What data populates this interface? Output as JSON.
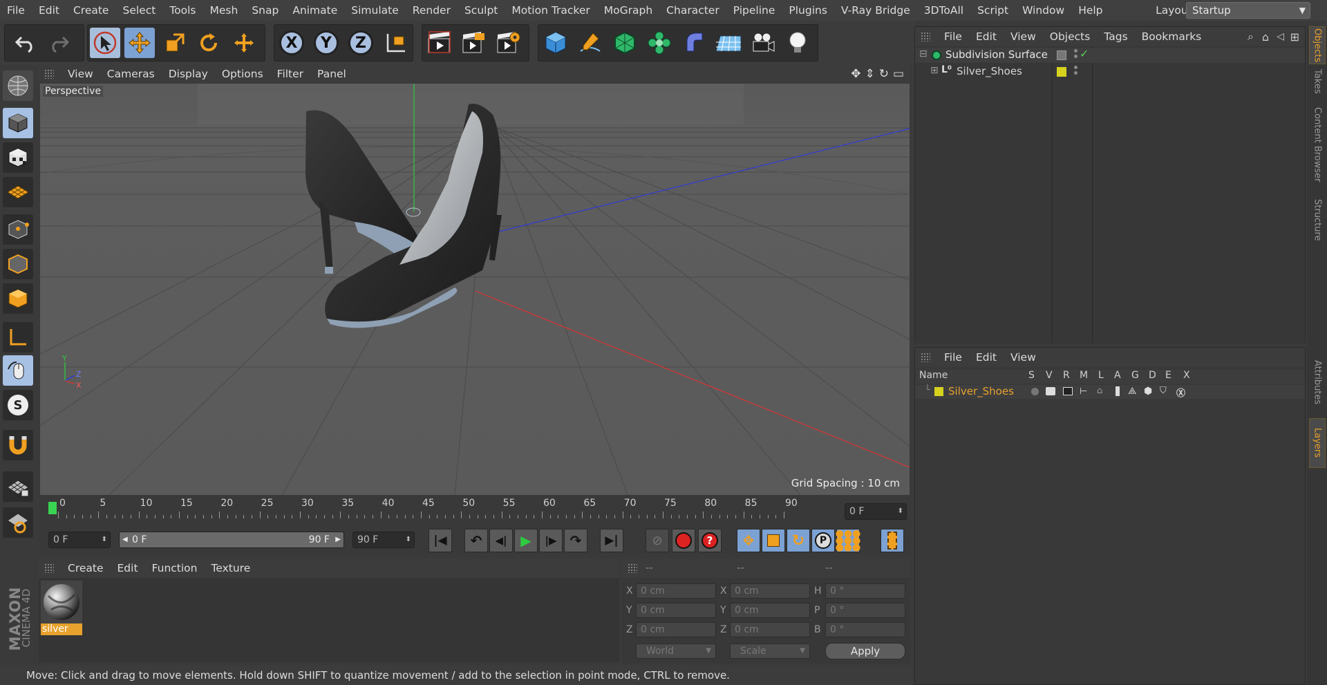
{
  "menubar": {
    "items": [
      "File",
      "Edit",
      "Create",
      "Select",
      "Tools",
      "Mesh",
      "Snap",
      "Animate",
      "Simulate",
      "Render",
      "Sculpt",
      "Motion Tracker",
      "MoGraph",
      "Character",
      "Pipeline",
      "Plugins",
      "V-Ray Bridge",
      "3DToAll",
      "Script",
      "Window",
      "Help"
    ],
    "layout_label": "Layout:",
    "layout_value": "Startup"
  },
  "toolbar": {
    "axis_x": "X",
    "axis_y": "Y",
    "axis_z": "Z"
  },
  "viewport": {
    "menu": [
      "View",
      "Cameras",
      "Display",
      "Options",
      "Filter",
      "Panel"
    ],
    "label": "Perspective",
    "grid_spacing": "Grid Spacing : 10 cm",
    "axis_y": "Y",
    "axis_z": "Z",
    "axis_x": "X"
  },
  "timeline": {
    "ticks": [
      "0",
      "5",
      "10",
      "15",
      "20",
      "25",
      "30",
      "35",
      "40",
      "45",
      "50",
      "55",
      "60",
      "65",
      "70",
      "75",
      "80",
      "85",
      "90"
    ],
    "current_frame": "0 F"
  },
  "transport": {
    "start_field": "0 F",
    "range_start": "0 F",
    "range_end": "90 F",
    "end_field": "90 F"
  },
  "material_manager": {
    "menu": [
      "Create",
      "Edit",
      "Function",
      "Texture"
    ],
    "material_name": "silver"
  },
  "coordinates": {
    "headers": [
      "--",
      "--",
      "--"
    ],
    "rows": [
      {
        "l1": "X",
        "v1": "0 cm",
        "l2": "X",
        "v2": "0 cm",
        "l3": "H",
        "v3": "0 °"
      },
      {
        "l1": "Y",
        "v1": "0 cm",
        "l2": "Y",
        "v2": "0 cm",
        "l3": "P",
        "v3": "0 °"
      },
      {
        "l1": "Z",
        "v1": "0 cm",
        "l2": "Z",
        "v2": "0 cm",
        "l3": "B",
        "v3": "0 °"
      }
    ],
    "mode": "World",
    "scale": "Scale",
    "apply": "Apply"
  },
  "status": "Move: Click and drag to move elements. Hold down SHIFT to quantize movement / add to the selection in point mode, CTRL to remove.",
  "object_manager": {
    "menu": [
      "File",
      "Edit",
      "View",
      "Objects",
      "Tags",
      "Bookmarks"
    ],
    "objects": [
      {
        "name": "Subdivision Surface"
      },
      {
        "name": "Silver_Shoes"
      }
    ]
  },
  "attribute_manager": {
    "menu": [
      "File",
      "Edit",
      "View"
    ],
    "columns": [
      "Name",
      "S",
      "V",
      "R",
      "M",
      "L",
      "A",
      "G",
      "D",
      "E",
      "X"
    ],
    "layer_name": "Silver_Shoes"
  },
  "side_tabs": [
    "Objects",
    "Takes",
    "Content Browser",
    "Structure",
    "Attributes",
    "Layers"
  ],
  "brand": {
    "line1": "MAXON",
    "line2": "CINEMA 4D"
  },
  "colors": {
    "accent": "#e8a12d",
    "selected": "#7ca1d3",
    "layer_yellow": "#d7d21f"
  }
}
